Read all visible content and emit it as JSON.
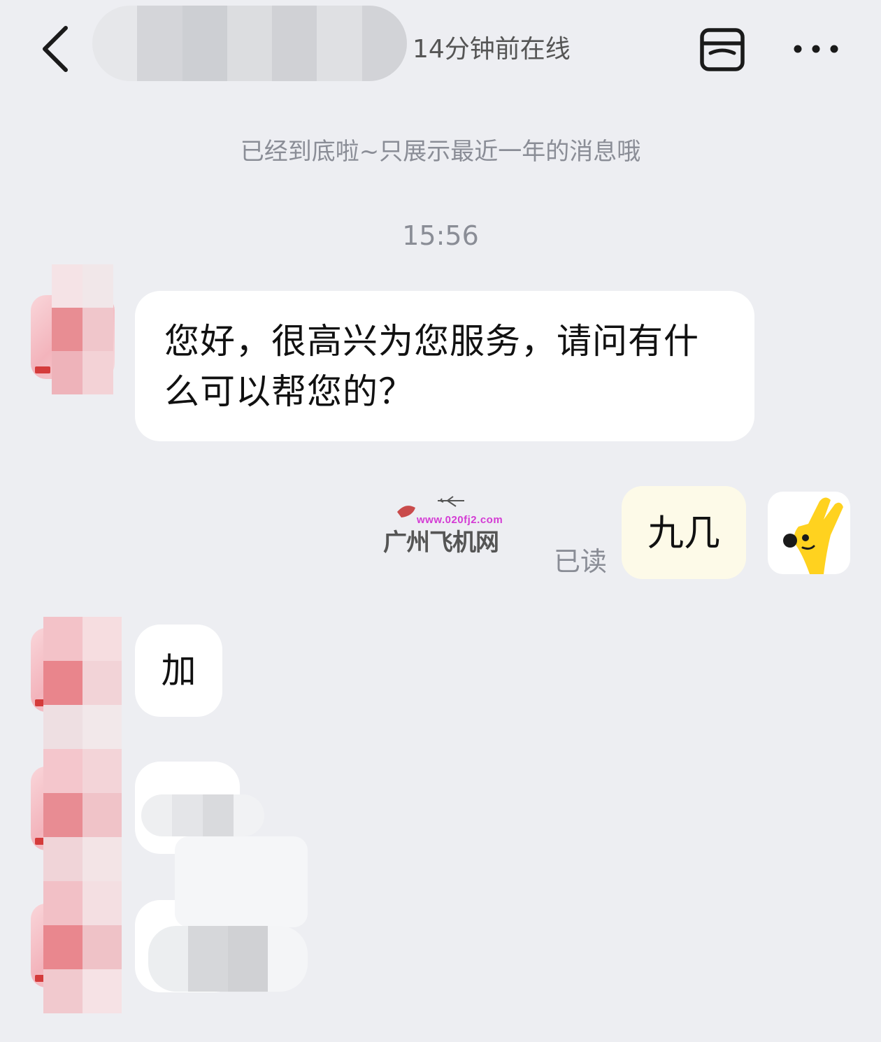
{
  "header": {
    "back_icon": "chevron-left-icon",
    "contact_name_redacted": true,
    "online_status": "14分钟前在线",
    "shop_icon": "store-icon",
    "more_icon": "more-horizontal-icon"
  },
  "notices": {
    "end_of_history": "已经到底啦~只展示最近一年的消息哦",
    "timestamp": "15:56"
  },
  "messages": [
    {
      "side": "incoming",
      "text": "您好，很高兴为您服务，请问有什么可以帮您的？"
    },
    {
      "side": "outgoing",
      "text": "九几",
      "status": "已读"
    },
    {
      "side": "incoming",
      "text": "加"
    },
    {
      "side": "incoming",
      "text": "",
      "redacted": true
    },
    {
      "side": "incoming",
      "text": "",
      "redacted": true
    }
  ],
  "watermark": {
    "url": "www.020fj2.com",
    "brand": "广州飞机网"
  },
  "colors": {
    "background": "#edeef2",
    "incoming_bubble": "#ffffff",
    "outgoing_bubble": "#fdfae8",
    "muted_text": "#8a8d96",
    "my_avatar_yellow": "#ffd21f"
  }
}
